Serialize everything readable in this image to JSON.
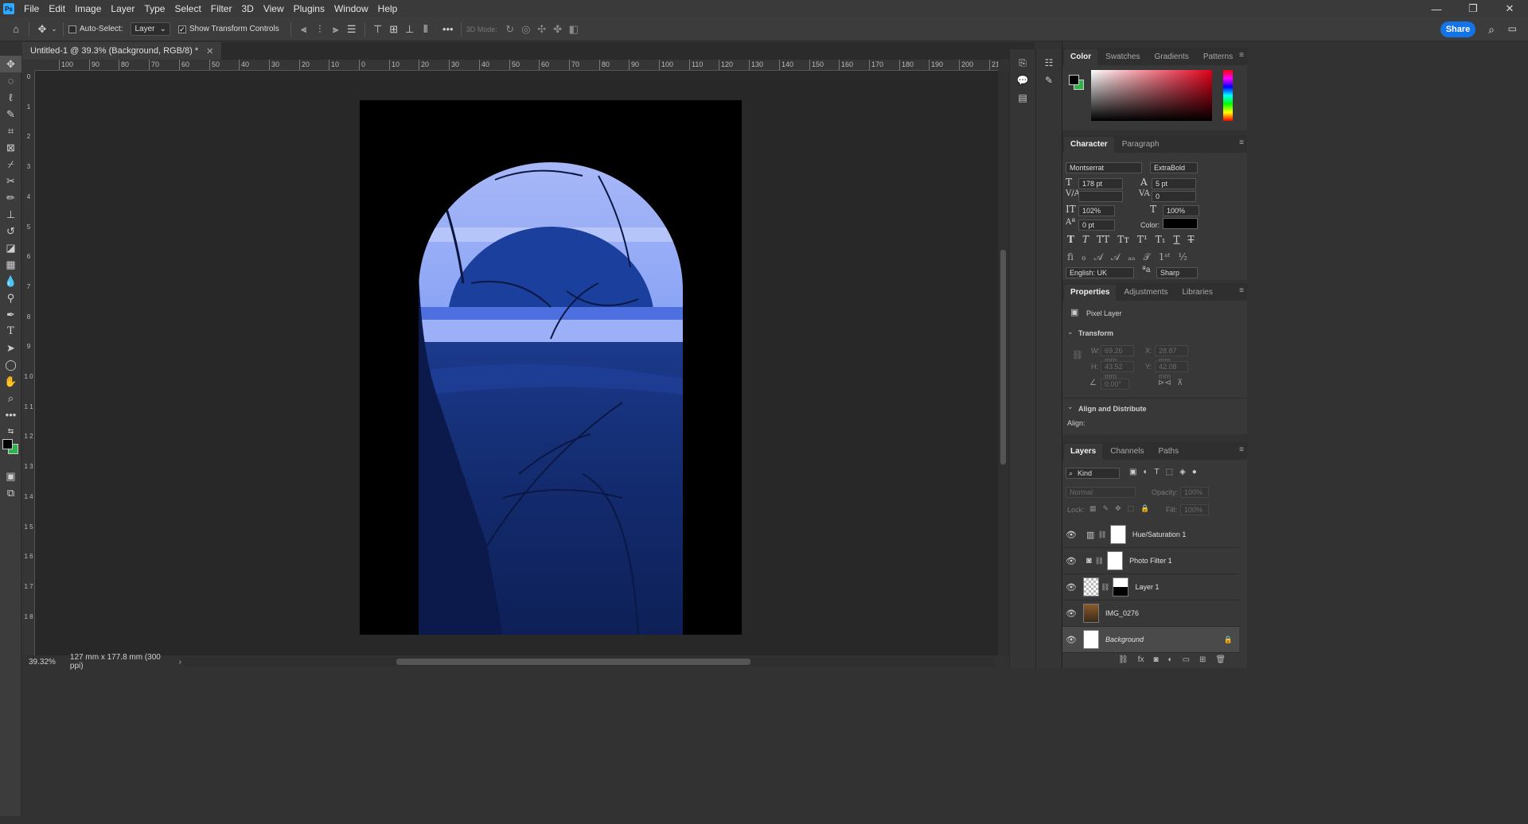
{
  "menubar": {
    "logo": "Ps",
    "items": [
      "File",
      "Edit",
      "Image",
      "Layer",
      "Type",
      "Select",
      "Filter",
      "3D",
      "View",
      "Plugins",
      "Window",
      "Help"
    ]
  },
  "optionsbar": {
    "auto_select_label": "Auto-Select:",
    "auto_select_target": "Layer",
    "show_transform_label": "Show Transform Controls",
    "mode_3d_label": "3D Mode:",
    "share_label": "Share"
  },
  "document": {
    "tab_title": "Untitled-1 @ 39.3% (Background, RGB/8) *",
    "zoom": "39.32%",
    "doc_size": "127 mm x 177.8 mm (300 ppi)"
  },
  "ruler": {
    "h_labels": [
      "100",
      "90",
      "80",
      "70",
      "60",
      "50",
      "40",
      "30",
      "20",
      "10",
      "0",
      "10",
      "20",
      "30",
      "40",
      "50",
      "60",
      "70",
      "80",
      "90",
      "100",
      "110",
      "120",
      "130",
      "140",
      "150",
      "160",
      "170",
      "180",
      "190",
      "200",
      "21"
    ],
    "v_labels": [
      "0",
      "1",
      "2",
      "3",
      "4",
      "5",
      "6",
      "7",
      "8",
      "9",
      "1 0",
      "1 1",
      "1 2",
      "1 3",
      "1 4",
      "1 5",
      "1 6",
      "1 7",
      "1 8"
    ]
  },
  "color_panel": {
    "tabs": [
      "Color",
      "Swatches",
      "Gradients",
      "Patterns"
    ],
    "foreground": "#000000",
    "background": "#2fb34a"
  },
  "character_panel": {
    "tabs": [
      "Character",
      "Paragraph"
    ],
    "font_family": "Montserrat",
    "font_style": "ExtraBold",
    "font_size": "178 pt",
    "leading": "5 pt",
    "kerning": "",
    "tracking": "0",
    "vertical_scale": "102%",
    "horizontal_scale": "100%",
    "baseline_shift": "0 pt",
    "color_label": "Color:",
    "language": "English: UK",
    "antialias": "Sharp"
  },
  "properties_panel": {
    "tabs": [
      "Properties",
      "Adjustments",
      "Libraries"
    ],
    "layer_type": "Pixel Layer",
    "transform_label": "Transform",
    "w_label": "W:",
    "w_value": "69.26 mm",
    "x_label": "X:",
    "x_value": "28.87 mm",
    "h_label": "H:",
    "h_value": "43.52 mm",
    "y_label": "Y:",
    "y_value": "42.08 mm",
    "angle_value": "0.00°",
    "align_label": "Align and Distribute",
    "align_sub": "Align:"
  },
  "layers_panel": {
    "tabs": [
      "Layers",
      "Channels",
      "Paths"
    ],
    "filter_kind": "Kind",
    "blend_mode": "Normal",
    "opacity_label": "Opacity:",
    "opacity_value": "100%",
    "lock_label": "Lock:",
    "fill_label": "Fill:",
    "fill_value": "100%",
    "layers": [
      {
        "name": "Hue/Saturation 1"
      },
      {
        "name": "Photo Filter 1"
      },
      {
        "name": "Layer 1"
      },
      {
        "name": "IMG_0276"
      },
      {
        "name": "Background"
      }
    ]
  },
  "colors": {
    "accent": "#1473e6",
    "image_blue": "#1a3a8a",
    "sky_blue": "#7f9df5"
  }
}
